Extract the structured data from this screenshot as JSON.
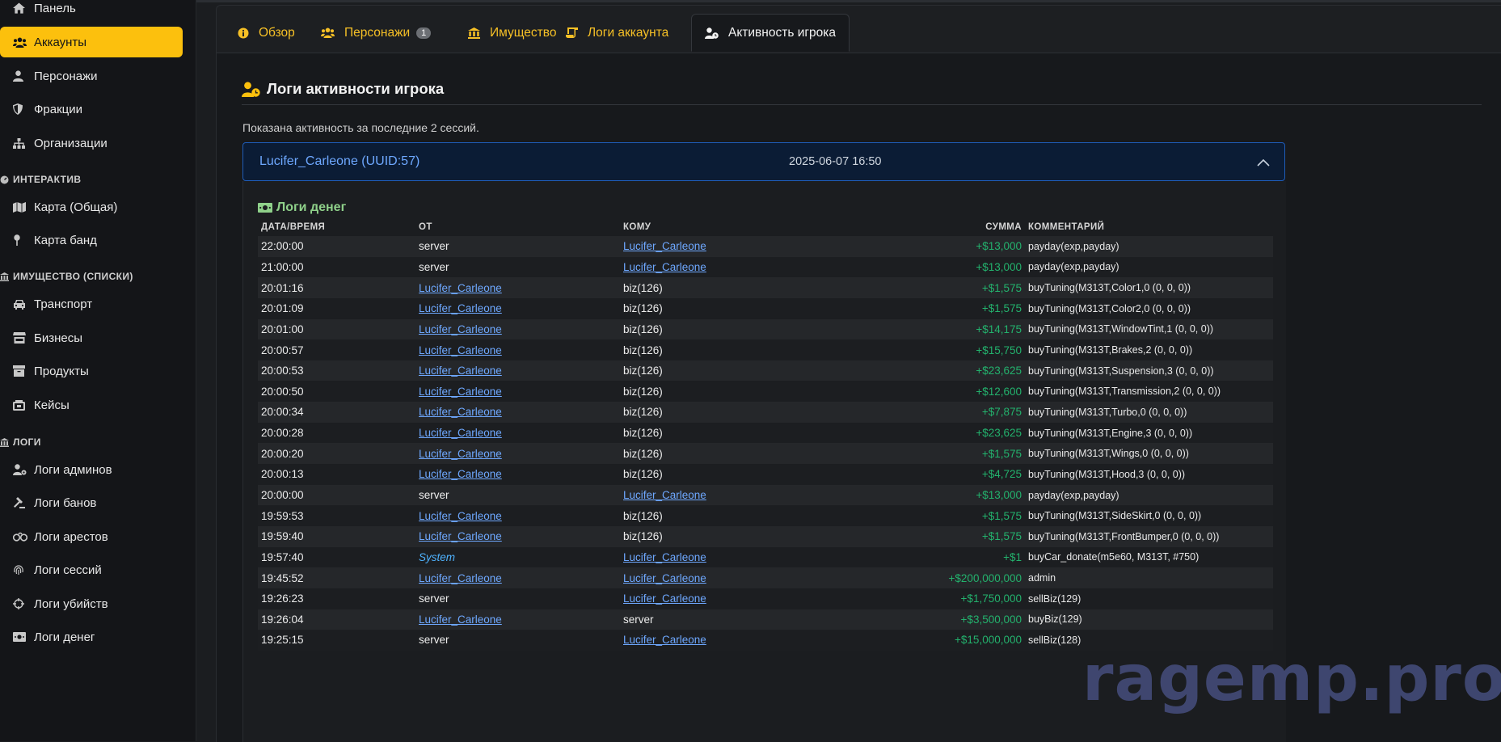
{
  "sidebar": {
    "items": [
      {
        "label": "Панель",
        "icon": "home-icon"
      },
      {
        "label": "Аккаунты",
        "icon": "users-icon",
        "active": true
      },
      {
        "label": "Персонажи",
        "icon": "user-icon"
      },
      {
        "label": "Фракции",
        "icon": "shield-icon"
      },
      {
        "label": "Организации",
        "icon": "sitemap-icon"
      }
    ],
    "section_interactive": "ИНТЕРАКТИВ",
    "interactive_items": [
      {
        "label": "Карта (Общая)",
        "icon": "map-icon"
      },
      {
        "label": "Карта банд",
        "icon": "map-pin-icon"
      }
    ],
    "section_property": "ИМУЩЕСТВО (СПИСКИ)",
    "property_items": [
      {
        "label": "Транспорт",
        "icon": "car-icon"
      },
      {
        "label": "Бизнесы",
        "icon": "store-icon"
      },
      {
        "label": "Продукты",
        "icon": "box-icon"
      },
      {
        "label": "Кейсы",
        "icon": "case-icon"
      }
    ],
    "section_logs": "ЛОГИ",
    "log_items": [
      {
        "label": "Логи админов",
        "icon": "user-gear-icon"
      },
      {
        "label": "Логи банов",
        "icon": "gavel-icon"
      },
      {
        "label": "Логи арестов",
        "icon": "handcuffs-icon"
      },
      {
        "label": "Логи сессий",
        "icon": "fingerprint-icon"
      },
      {
        "label": "Логи убийств",
        "icon": "crosshair-icon"
      },
      {
        "label": "Логи денег",
        "icon": "money-icon"
      }
    ]
  },
  "tabs": [
    {
      "label": "Обзор",
      "icon": "info-circle-icon"
    },
    {
      "label": "Персонажи",
      "icon": "users-icon",
      "badge": "1"
    },
    {
      "label": "Имущество",
      "icon": "bank-icon"
    },
    {
      "label": "Логи аккаунта",
      "icon": "scroll-icon"
    },
    {
      "label": "Активность игрока",
      "icon": "user-clock-icon",
      "active": true
    }
  ],
  "main": {
    "title": "Логи активности игрока",
    "subtitle": "Показана активность за последние 2 сессий.",
    "session": {
      "name": "Lucifer_Carleone (UUID:57)",
      "date": "2025-06-07 16:50"
    },
    "money_logs_title": "Логи денег",
    "columns": [
      "ДАТА/ВРЕМЯ",
      "ОТ",
      "КОМУ",
      "СУММА",
      "КОММЕНТАРИЙ"
    ],
    "rows": [
      {
        "time": "22:00:00",
        "from": "server",
        "to": "Lucifer_Carleone",
        "amount": "+$13,000",
        "comment": "payday(exp,payday)"
      },
      {
        "time": "21:00:00",
        "from": "server",
        "to": "Lucifer_Carleone",
        "amount": "+$13,000",
        "comment": "payday(exp,payday)"
      },
      {
        "time": "20:01:16",
        "from": "Lucifer_Carleone",
        "to": "biz(126)",
        "amount": "+$1,575",
        "comment": "buyTuning(M313T,Color1,0 (0, 0, 0))"
      },
      {
        "time": "20:01:09",
        "from": "Lucifer_Carleone",
        "to": "biz(126)",
        "amount": "+$1,575",
        "comment": "buyTuning(M313T,Color2,0 (0, 0, 0))"
      },
      {
        "time": "20:01:00",
        "from": "Lucifer_Carleone",
        "to": "biz(126)",
        "amount": "+$14,175",
        "comment": "buyTuning(M313T,WindowTint,1 (0, 0, 0))"
      },
      {
        "time": "20:00:57",
        "from": "Lucifer_Carleone",
        "to": "biz(126)",
        "amount": "+$15,750",
        "comment": "buyTuning(M313T,Brakes,2 (0, 0, 0))"
      },
      {
        "time": "20:00:53",
        "from": "Lucifer_Carleone",
        "to": "biz(126)",
        "amount": "+$23,625",
        "comment": "buyTuning(M313T,Suspension,3 (0, 0, 0))"
      },
      {
        "time": "20:00:50",
        "from": "Lucifer_Carleone",
        "to": "biz(126)",
        "amount": "+$12,600",
        "comment": "buyTuning(M313T,Transmission,2 (0, 0, 0))"
      },
      {
        "time": "20:00:34",
        "from": "Lucifer_Carleone",
        "to": "biz(126)",
        "amount": "+$7,875",
        "comment": "buyTuning(M313T,Turbo,0 (0, 0, 0))"
      },
      {
        "time": "20:00:28",
        "from": "Lucifer_Carleone",
        "to": "biz(126)",
        "amount": "+$23,625",
        "comment": "buyTuning(M313T,Engine,3 (0, 0, 0))"
      },
      {
        "time": "20:00:20",
        "from": "Lucifer_Carleone",
        "to": "biz(126)",
        "amount": "+$1,575",
        "comment": "buyTuning(M313T,Wings,0 (0, 0, 0))"
      },
      {
        "time": "20:00:13",
        "from": "Lucifer_Carleone",
        "to": "biz(126)",
        "amount": "+$4,725",
        "comment": "buyTuning(M313T,Hood,3 (0, 0, 0))"
      },
      {
        "time": "20:00:00",
        "from": "server",
        "to": "Lucifer_Carleone",
        "amount": "+$13,000",
        "comment": "payday(exp,payday)"
      },
      {
        "time": "19:59:53",
        "from": "Lucifer_Carleone",
        "to": "biz(126)",
        "amount": "+$1,575",
        "comment": "buyTuning(M313T,SideSkirt,0 (0, 0, 0))"
      },
      {
        "time": "19:59:40",
        "from": "Lucifer_Carleone",
        "to": "biz(126)",
        "amount": "+$1,575",
        "comment": "buyTuning(M313T,FrontBumper,0 (0, 0, 0))"
      },
      {
        "time": "19:57:40",
        "from": "System",
        "to": "Lucifer_Carleone",
        "amount": "+$1",
        "comment": "buyCar_donate(m5e60, M313T, #750)"
      },
      {
        "time": "19:45:52",
        "from": "Lucifer_Carleone",
        "to": "Lucifer_Carleone",
        "amount": "+$200,000,000",
        "comment": "admin"
      },
      {
        "time": "19:26:23",
        "from": "server",
        "to": "Lucifer_Carleone",
        "amount": "+$1,750,000",
        "comment": "sellBiz(129)"
      },
      {
        "time": "19:26:04",
        "from": "Lucifer_Carleone",
        "to": "server",
        "amount": "+$3,500,000",
        "comment": "buyBiz(129)"
      },
      {
        "time": "19:25:15",
        "from": "server",
        "to": "Lucifer_Carleone",
        "amount": "+$15,000,000",
        "comment": "sellBiz(128)"
      }
    ]
  },
  "watermark": "ragemp.pro",
  "colors": {
    "accent": "#fcc00d",
    "amount_positive": "#23b26d",
    "link": "#6ea8ff",
    "session_border": "#1e5cb8"
  }
}
